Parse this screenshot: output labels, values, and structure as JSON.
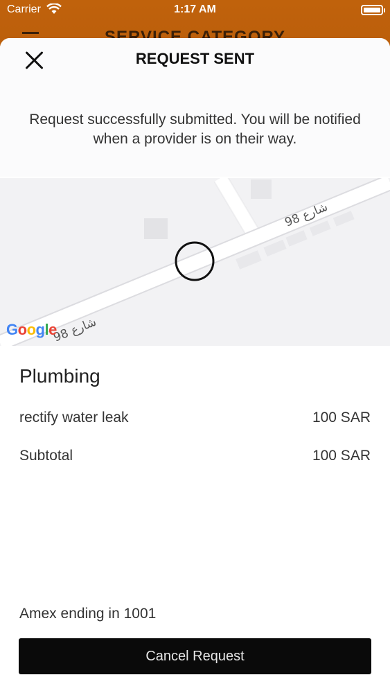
{
  "status_bar": {
    "carrier": "Carrier",
    "time": "1:17 AM"
  },
  "background_app": {
    "title": "SERVICE CATEGORY"
  },
  "sheet": {
    "title": "REQUEST SENT",
    "message": "Request successfully submitted.  You will be notified when a provider is on their way."
  },
  "map": {
    "street_label_1": "شارع 98",
    "street_label_2": "شارع 98",
    "logo": {
      "g1": "G",
      "o1": "o",
      "o2": "o",
      "g2": "g",
      "l": "l",
      "e": "e"
    }
  },
  "order": {
    "category": "Plumbing",
    "item_name": "rectify water leak",
    "item_price": "100 SAR",
    "subtotal_label": "Subtotal",
    "subtotal_value": "100 SAR"
  },
  "payment": {
    "method": "Amex ending in 1001"
  },
  "actions": {
    "cancel_label": "Cancel Request"
  },
  "colors": {
    "brand_orange": "#c96a0e",
    "button_black": "#0a0a0a"
  },
  "icons": {
    "close": "close-icon",
    "wifi": "wifi-icon",
    "battery": "battery-icon",
    "menu": "menu-icon",
    "location": "location-marker-icon"
  }
}
